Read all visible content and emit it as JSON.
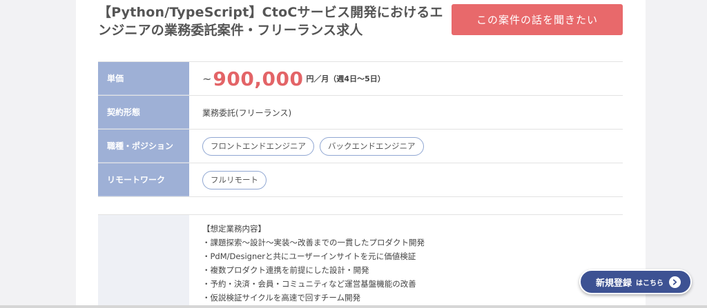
{
  "job": {
    "title": "【Python/TypeScript】CtoCサービス開発におけるエンジニアの業務委託案件・フリーランス求人",
    "cta_label": "この案件の話を聞きたい"
  },
  "details": {
    "price": {
      "label": "単価",
      "tilde": "~",
      "amount": "900,000",
      "unit": "円／月（週4日〜5日）"
    },
    "contract": {
      "label": "契約形態",
      "value": "業務委託(フリーランス)"
    },
    "position": {
      "label": "職種・ポジション",
      "tags": [
        "フロントエンドエンジニア",
        "バックエンドエンジニア"
      ]
    },
    "remote": {
      "label": "リモートワーク",
      "tags": [
        "フルリモート"
      ]
    }
  },
  "description": {
    "lines": [
      "【想定業務内容】",
      "・課題探索〜設計〜実装〜改善までの一貫したプロダクト開発",
      "・PdM/Designerと共にユーザーインサイトを元に価値検証",
      "・複数プロダクト連携を前提にした設計・開発",
      "・予約・決済・会員・コミュニティなど運営基盤機能の改善",
      "・仮説検証サイクルを高速で回すチーム開発"
    ]
  },
  "floating": {
    "register_main": "新規登録",
    "register_sub": "はこちら",
    "arrow_icon": "chevron-right-icon"
  },
  "colors": {
    "accent": "#e8696b",
    "price": "#e36467",
    "label_bg": "#9eb0d6",
    "tag_border": "#8fa6d2",
    "register_bg": "#3d5293"
  }
}
